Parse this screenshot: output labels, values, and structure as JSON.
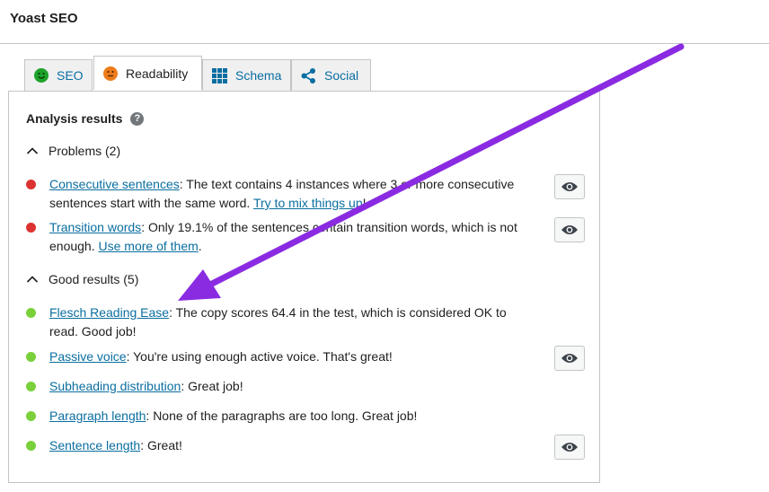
{
  "panel": {
    "title": "Yoast SEO"
  },
  "tabs": [
    {
      "label": "SEO",
      "icon": "smiley-green-icon"
    },
    {
      "label": "Readability",
      "icon": "smiley-orange-icon"
    },
    {
      "label": "Schema",
      "icon": "grid-icon"
    },
    {
      "label": "Social",
      "icon": "share-icon"
    }
  ],
  "analysis": {
    "heading": "Analysis results",
    "help_glyph": "?",
    "problems": {
      "label": "Problems (2)",
      "items": [
        {
          "link": "Consecutive sentences",
          "text": ": The text contains 4 instances where 3 or more consecutive sentences start with the same word. ",
          "link2": "Try to mix things up",
          "text2": "!"
        },
        {
          "link": "Transition words",
          "text": ": Only 19.1% of the sentences contain transition words, which is not enough. ",
          "link2": "Use more of them",
          "text2": "."
        }
      ]
    },
    "good": {
      "label": "Good results (5)",
      "items": [
        {
          "link": "Flesch Reading Ease",
          "text": ": The copy scores 64.4 in the test, which is considered OK to read. Good job!"
        },
        {
          "link": "Passive voice",
          "text": ": You're using enough active voice. That's great!"
        },
        {
          "link": "Subheading distribution",
          "text": ": Great job!"
        },
        {
          "link": "Paragraph length",
          "text": ": None of the paragraphs are too long. Great job!"
        },
        {
          "link": "Sentence length",
          "text": ": Great!"
        }
      ]
    }
  },
  "colors": {
    "problem": "#dc3232",
    "good": "#7ad03a",
    "link": "#0a6ea0",
    "arrow": "#8a2be2"
  }
}
